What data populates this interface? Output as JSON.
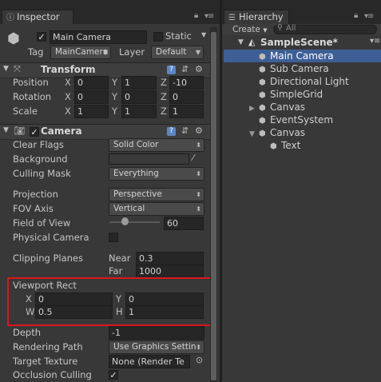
{
  "inspector": {
    "tab_label": "Inspector",
    "object_name": "Main Camera",
    "static_label": "Static",
    "tag_label": "Tag",
    "tag_value": "MainCamera",
    "layer_label": "Layer",
    "layer_value": "Default",
    "transform": {
      "title": "Transform",
      "position_label": "Position",
      "position": {
        "x": "0",
        "y": "1",
        "z": "-10"
      },
      "rotation_label": "Rotation",
      "rotation": {
        "x": "0",
        "y": "0",
        "z": "0"
      },
      "scale_label": "Scale",
      "scale": {
        "x": "1",
        "y": "1",
        "z": "1"
      },
      "axis_x": "X",
      "axis_y": "Y",
      "axis_z": "Z"
    },
    "camera": {
      "title": "Camera",
      "clear_flags_label": "Clear Flags",
      "clear_flags_value": "Solid Color",
      "background_label": "Background",
      "culling_mask_label": "Culling Mask",
      "culling_mask_value": "Everything",
      "projection_label": "Projection",
      "projection_value": "Perspective",
      "fov_axis_label": "FOV Axis",
      "fov_axis_value": "Vertical",
      "fov_label": "Field of View",
      "fov_value": "60",
      "physical_camera_label": "Physical Camera",
      "clipping_planes_label": "Clipping Planes",
      "near_label": "Near",
      "near_value": "0.3",
      "far_label": "Far",
      "far_value": "1000",
      "viewport_rect_label": "Viewport Rect",
      "viewport": {
        "x_label": "X",
        "x": "0",
        "y_label": "Y",
        "y": "0",
        "w_label": "W",
        "w": "0.5",
        "h_label": "H",
        "h": "1"
      },
      "depth_label": "Depth",
      "depth_value": "-1",
      "rendering_path_label": "Rendering Path",
      "rendering_path_value": "Use Graphics Settin",
      "target_texture_label": "Target Texture",
      "target_texture_value": "None (Render Te",
      "occlusion_culling_label": "Occlusion Culling"
    }
  },
  "hierarchy": {
    "tab_label": "Hierarchy",
    "create_label": "Create",
    "search_placeholder": "All",
    "scene_name": "SampleScene*",
    "items": [
      {
        "label": "Main Camera"
      },
      {
        "label": "Sub Camera"
      },
      {
        "label": "Directional Light"
      },
      {
        "label": "SimpleGrid"
      },
      {
        "label": "Canvas"
      },
      {
        "label": "EventSystem"
      },
      {
        "label": "Canvas"
      },
      {
        "label": "Text"
      }
    ]
  },
  "colors": {
    "selection": "#3e5f96",
    "highlight_box": "#e0141e",
    "background_swatch": "#3a3a3a"
  }
}
